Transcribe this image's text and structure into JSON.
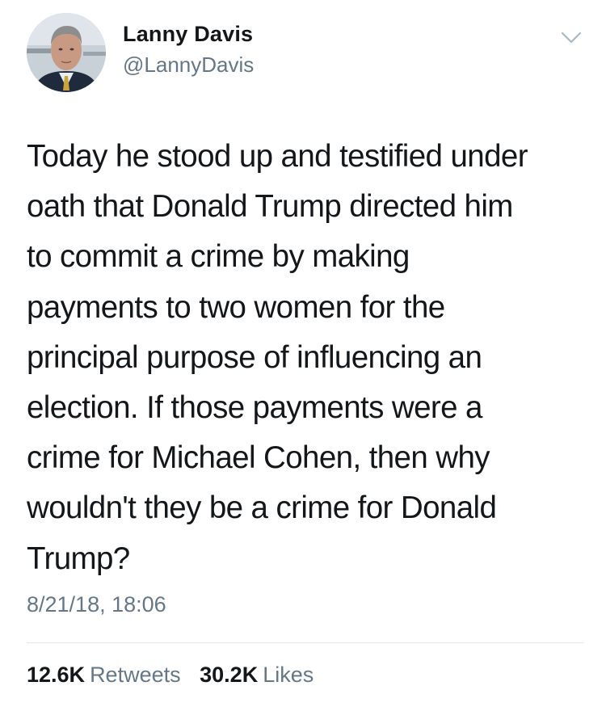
{
  "author": {
    "name": "Lanny Davis",
    "handle": "@LannyDavis"
  },
  "tweet": {
    "text": "Today he stood up and testified under\noath that Donald Trump directed him\nto commit a crime by making\npayments to two women for the\nprincipal purpose of influencing an\nelection.  If those payments were a\ncrime for Michael Cohen, then why\nwouldn't they be a crime for Donald\nTrump?",
    "timestamp": "8/21/18, 18:06"
  },
  "stats": {
    "retweets_count": "12.6K",
    "retweets_label": "Retweets",
    "likes_count": "30.2K",
    "likes_label": "Likes"
  },
  "icons": {
    "menu": "chevron-down-icon"
  },
  "colors": {
    "primary_text": "#14171a",
    "secondary_text": "#657786",
    "divider": "#e1e8ed"
  }
}
